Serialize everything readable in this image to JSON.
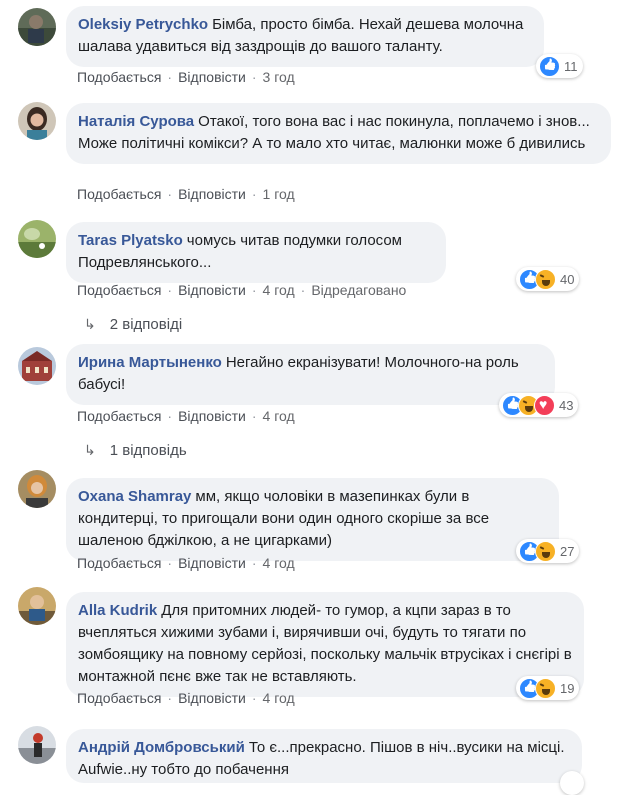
{
  "comments": [
    {
      "author": "Oleksiy Petrychko",
      "text": "Бімба, просто бімба. Нехай дешева молочна шалава удавиться від заздрощів до вашого таланту.",
      "like": "Подобається",
      "reply": "Відповісти",
      "time": "3 год",
      "reaction_count": "11"
    },
    {
      "author": "Наталія Сурова",
      "text": "Отакої, того вона вас і нас покинула, поплачемо і знов... Може політичні комікси? А то мало хто читає, малюнки може б дивились",
      "like": "Подобається",
      "reply": "Відповісти",
      "time": "1 год"
    },
    {
      "author": "Taras Plyatsko",
      "text": "чомусь читав подумки голосом Подревлянського...",
      "like": "Подобається",
      "reply": "Відповісти",
      "time": "4 год",
      "edited": "Відредаговано",
      "reaction_count": "40",
      "replies_label": "2 відповіді"
    },
    {
      "author": "Ирина Мартыненко",
      "text": "Негайно екранізувати! Молочного-на роль бабусі!",
      "like": "Подобається",
      "reply": "Відповісти",
      "time": "4 год",
      "reaction_count": "43",
      "replies_label": "1 відповідь"
    },
    {
      "author": "Oxana Shamray",
      "text": "мм, якщо чоловіки в мазепинках були в кондитерці, то пригощали вони один одного скоріше за все шаленою бджілкою, а не цигарками)",
      "like": "Подобається",
      "reply": "Відповісти",
      "time": "4 год",
      "reaction_count": "27"
    },
    {
      "author": "Alla Kudrik",
      "text": "Для притомних людей- то гумор, а кцпи зараз в то вчепляться хижими зубами і, вирячивши очі, будуть то тягати по зомбоящику на повному серйозі, поскольку мальчік втрусіках і снєгірі в монтажной пєнє вже так не вставляють.",
      "like": "Подобається",
      "reply": "Відповісти",
      "time": "4 год",
      "reaction_count": "19"
    },
    {
      "author": "Андрій Домбровський",
      "text": "То є...прекрасно. Пішов в ніч..вусики на місці. Aufwie..ну тобто до побачення"
    }
  ],
  "colors": {
    "author": "#385898",
    "bubble": "#f0f2f5",
    "like_blue": "#2d88ff",
    "haha_yellow": "#f7b125",
    "love_red": "#f33e58"
  },
  "icons": {
    "reply_arrow": "reply-arrow-icon",
    "like": "like-reaction-icon",
    "haha": "haha-reaction-icon",
    "love": "love-reaction-icon"
  }
}
